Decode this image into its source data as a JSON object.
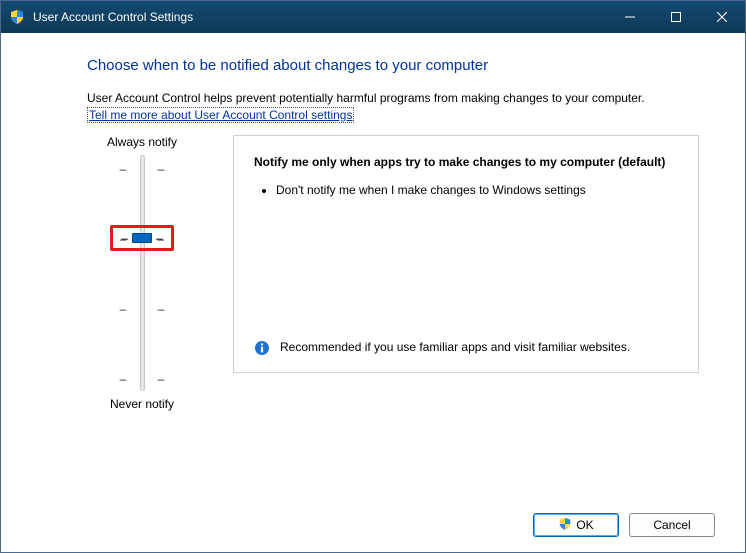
{
  "window": {
    "title": "User Account Control Settings"
  },
  "page": {
    "heading": "Choose when to be notified about changes to your computer",
    "intro": "User Account Control helps prevent potentially harmful programs from making changes to your computer.",
    "link": "Tell me more about User Account Control settings"
  },
  "slider": {
    "top_label": "Always notify",
    "bottom_label": "Never notify"
  },
  "description": {
    "title": "Notify me only when apps try to make changes to my computer (default)",
    "bullet1": "Don't notify me when I make changes to Windows settings",
    "recommend": "Recommended if you use familiar apps and visit familiar websites."
  },
  "buttons": {
    "ok": "OK",
    "cancel": "Cancel"
  }
}
